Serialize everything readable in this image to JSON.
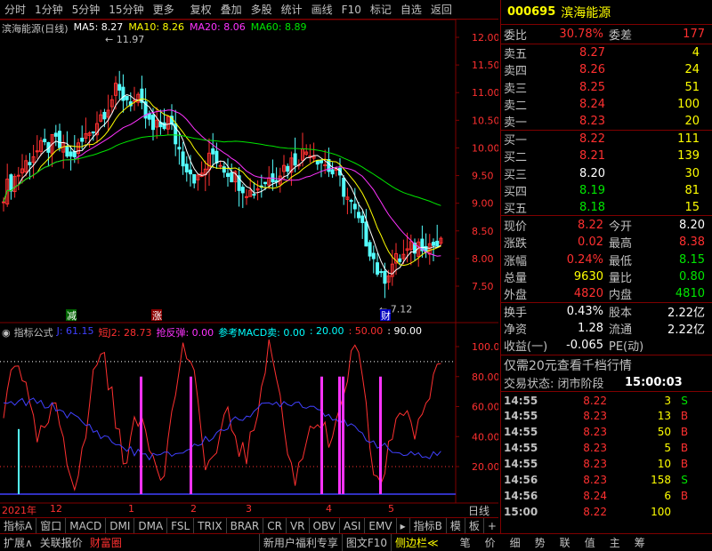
{
  "toolbar": {
    "items": [
      "分时",
      "1分钟",
      "5分钟",
      "15分钟",
      "更多",
      "复权",
      "叠加",
      "多股",
      "统计",
      "画线",
      "F10",
      "标记",
      "自选",
      "返回"
    ]
  },
  "main_chart": {
    "title": "滨海能源(日线)",
    "ma_labels": [
      {
        "text": "MA5: 8.27",
        "color": "#ffffff"
      },
      {
        "text": "MA10: 8.26",
        "color": "#ffff00"
      },
      {
        "text": "MA20: 8.06",
        "color": "#ff33ff"
      },
      {
        "text": "MA60: 8.89",
        "color": "#00e600"
      }
    ],
    "high_marker": "11.97",
    "low_marker": "7.12",
    "ticks": [
      "12.00",
      "11.50",
      "11.00",
      "10.50",
      "10.00",
      "9.50",
      "9.00",
      "8.50",
      "8.00",
      "7.50"
    ],
    "badges": {
      "reduce": "减",
      "rise": "涨",
      "finance": "财"
    }
  },
  "indicator": {
    "title": "指标公式",
    "labels": [
      {
        "text": "J: 61.15",
        "color": "#4040ff"
      },
      {
        "text": "短J2: 28.73",
        "color": "#ff3030"
      },
      {
        "text": "抢反弹: 0.00",
        "color": "#ff33ff"
      },
      {
        "text": "参考MACD卖: 0.00",
        "color": "#00ffff"
      },
      {
        "text": ": 20.00",
        "color": "#00ffff"
      },
      {
        "text": ": 50.00",
        "color": "#ff3030"
      },
      {
        "text": ": 90.00",
        "color": "#ffffff"
      }
    ],
    "ticks": [
      "100.0",
      "80.00",
      "60.00",
      "40.00",
      "20.00"
    ]
  },
  "x_axis": {
    "labels": [
      "2021年",
      "12",
      "1",
      "2",
      "3",
      "4",
      "5"
    ],
    "right_label": "日线"
  },
  "bottom_tabs": [
    "指标A",
    "窗口",
    "MACD",
    "DMI",
    "DMA",
    "FSL",
    "TRIX",
    "BRAR",
    "CR",
    "VR",
    "OBV",
    "ASI",
    "EMV",
    "▸",
    "指标B",
    "模",
    "板",
    "+",
    "−"
  ],
  "status_bar": {
    "left": [
      "扩展∧",
      "关联报价",
      "财富圈"
    ],
    "middle": [
      "新用户福利专享",
      "图文F10",
      "侧边栏≪"
    ],
    "right": [
      "笔",
      "价",
      "细",
      "势",
      "联",
      "值",
      "主",
      "筹"
    ]
  },
  "stock": {
    "code": "000695",
    "name": "滨海能源"
  },
  "order_book": {
    "wei_bi_label": "委比",
    "wei_bi": "30.78%",
    "wei_cha_label": "委差",
    "wei_cha": "177",
    "sells": [
      {
        "label": "卖五",
        "price": "8.27",
        "vol": "4"
      },
      {
        "label": "卖四",
        "price": "8.26",
        "vol": "24"
      },
      {
        "label": "卖三",
        "price": "8.25",
        "vol": "51"
      },
      {
        "label": "卖二",
        "price": "8.24",
        "vol": "100"
      },
      {
        "label": "卖一",
        "price": "8.23",
        "vol": "20"
      }
    ],
    "buys": [
      {
        "label": "买一",
        "price": "8.22",
        "vol": "111"
      },
      {
        "label": "买二",
        "price": "8.21",
        "vol": "139"
      },
      {
        "label": "买三",
        "price": "8.20",
        "vol": "30"
      },
      {
        "label": "买四",
        "price": "8.19",
        "vol": "81"
      },
      {
        "label": "买五",
        "price": "8.18",
        "vol": "15"
      }
    ]
  },
  "quote": [
    {
      "l1": "现价",
      "v1": "8.22",
      "l2": "今开",
      "v2": "8.20"
    },
    {
      "l1": "涨跌",
      "v1": "0.02",
      "l2": "最高",
      "v2": "8.38"
    },
    {
      "l1": "涨幅",
      "v1": "0.24%",
      "l2": "最低",
      "v2": "8.15"
    },
    {
      "l1": "总量",
      "v1": "9630",
      "l2": "量比",
      "v2": "0.80"
    },
    {
      "l1": "外盘",
      "v1": "4820",
      "l2": "内盘",
      "v2": "4810"
    }
  ],
  "quote2": [
    {
      "l1": "换手",
      "v1": "0.43%",
      "l2": "股本",
      "v2": "2.22亿"
    },
    {
      "l1": "净资",
      "v1": "1.28",
      "l2": "流通",
      "v2": "2.22亿"
    },
    {
      "l1": "收益(一)",
      "v1": "-0.065",
      "l2": "PE(动)",
      "v2": ""
    }
  ],
  "promo": "仅需20元查看千档行情",
  "trade_status": {
    "label": "交易状态: 闭市阶段",
    "time": "15:00:03"
  },
  "trades": [
    {
      "t": "14:55",
      "p": "8.22",
      "v": "3",
      "s": "S"
    },
    {
      "t": "14:55",
      "p": "8.23",
      "v": "13",
      "s": "B"
    },
    {
      "t": "14:55",
      "p": "8.23",
      "v": "50",
      "s": "B"
    },
    {
      "t": "14:55",
      "p": "8.23",
      "v": "5",
      "s": "B"
    },
    {
      "t": "14:55",
      "p": "8.23",
      "v": "10",
      "s": "B"
    },
    {
      "t": "14:56",
      "p": "8.23",
      "v": "158",
      "s": "S"
    },
    {
      "t": "14:56",
      "p": "8.24",
      "v": "6",
      "s": "B"
    },
    {
      "t": "15:00",
      "p": "8.22",
      "v": "100",
      "s": ""
    }
  ]
}
